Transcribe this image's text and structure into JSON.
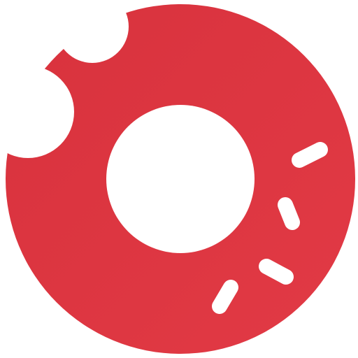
{
  "app": {
    "icon_name": "bitten-donut-icon",
    "colors": {
      "background": "#ffffff",
      "donut_fill": "#E23A45",
      "donut_fill_dark": "#D8323D",
      "hole": "#ffffff",
      "sprinkles": "#ffffff"
    },
    "sprinkle_count": 4
  }
}
